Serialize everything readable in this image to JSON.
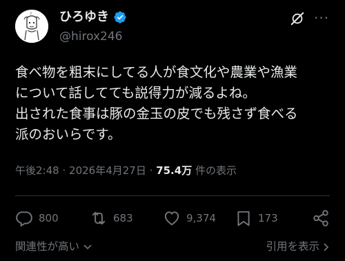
{
  "user": {
    "display_name": "ひろゆき",
    "handle": "@hirox246"
  },
  "tweet": {
    "text": "食べ物を粗末にしてる人が食文化や農業や漁業\nについて話してても説得力が減るよね。\n出された食事は豚の金玉の皮でも残さず食べる\n派のおいらです。"
  },
  "meta": {
    "time": "午後2:48",
    "separator": "·",
    "date": "2026年4月27日",
    "views_count": "75.4万",
    "views_label": "件の表示"
  },
  "actions": {
    "replies": "800",
    "reposts": "683",
    "likes": "9,374",
    "bookmarks": "173"
  },
  "bottom": {
    "sort_label": "関連性が高い",
    "quotes_link": "引用を表示"
  },
  "colors": {
    "background": "#000000",
    "text": "#e7e9ea",
    "muted": "#71767b",
    "verified": "#1d9bf0"
  }
}
